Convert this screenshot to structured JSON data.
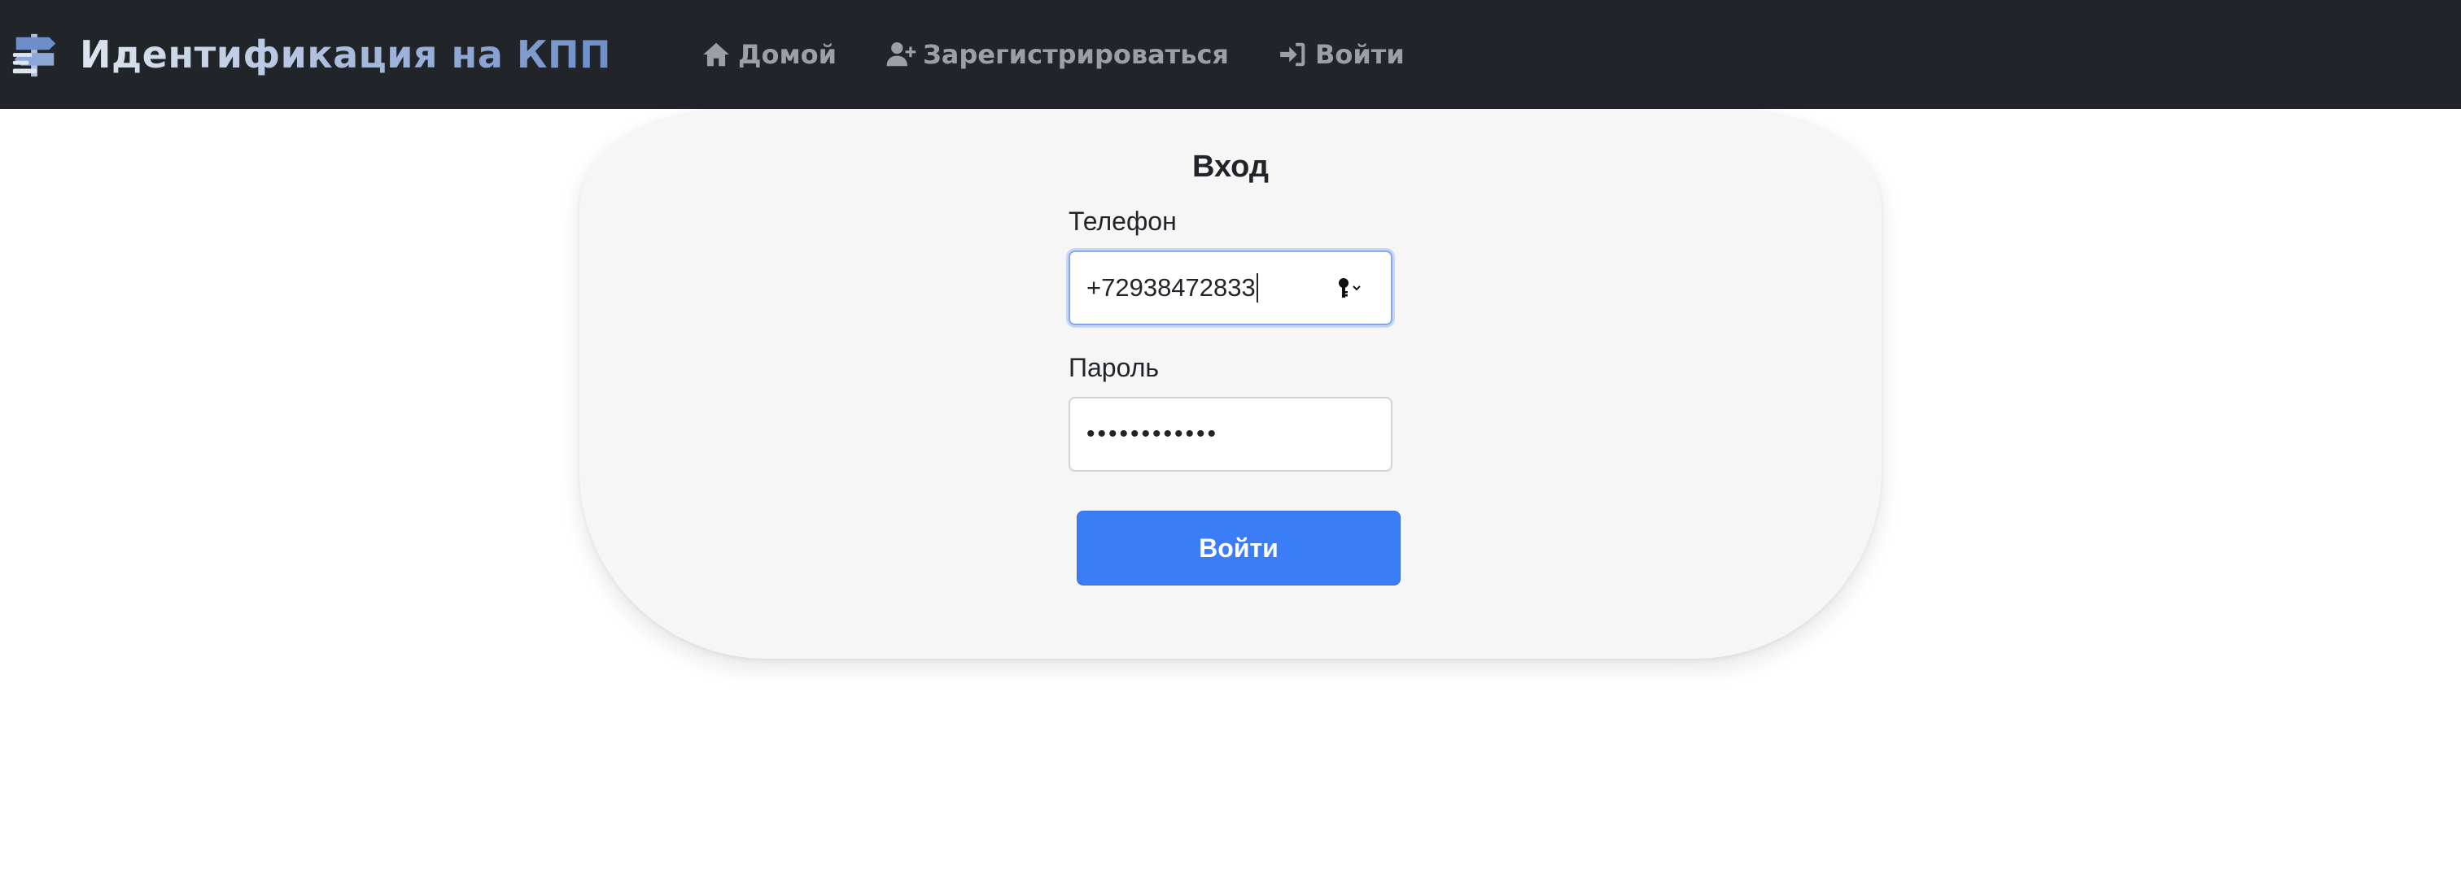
{
  "navbar": {
    "brand_title": "Идентификация на КПП",
    "links": [
      {
        "label": "Домой",
        "icon": "home-icon"
      },
      {
        "label": "Зарегистрироваться",
        "icon": "user-plus-icon"
      },
      {
        "label": "Войти",
        "icon": "sign-in-icon"
      }
    ]
  },
  "login": {
    "title": "Вход",
    "phone_label": "Телефон",
    "phone_value": "+72938472833",
    "password_label": "Пароль",
    "password_value": "••••••••••••",
    "submit_label": "Войти"
  },
  "colors": {
    "navbar_bg": "#212529",
    "card_bg": "#f6f6f6",
    "primary": "#3b7df7",
    "nav_link": "#9aa0a6"
  }
}
